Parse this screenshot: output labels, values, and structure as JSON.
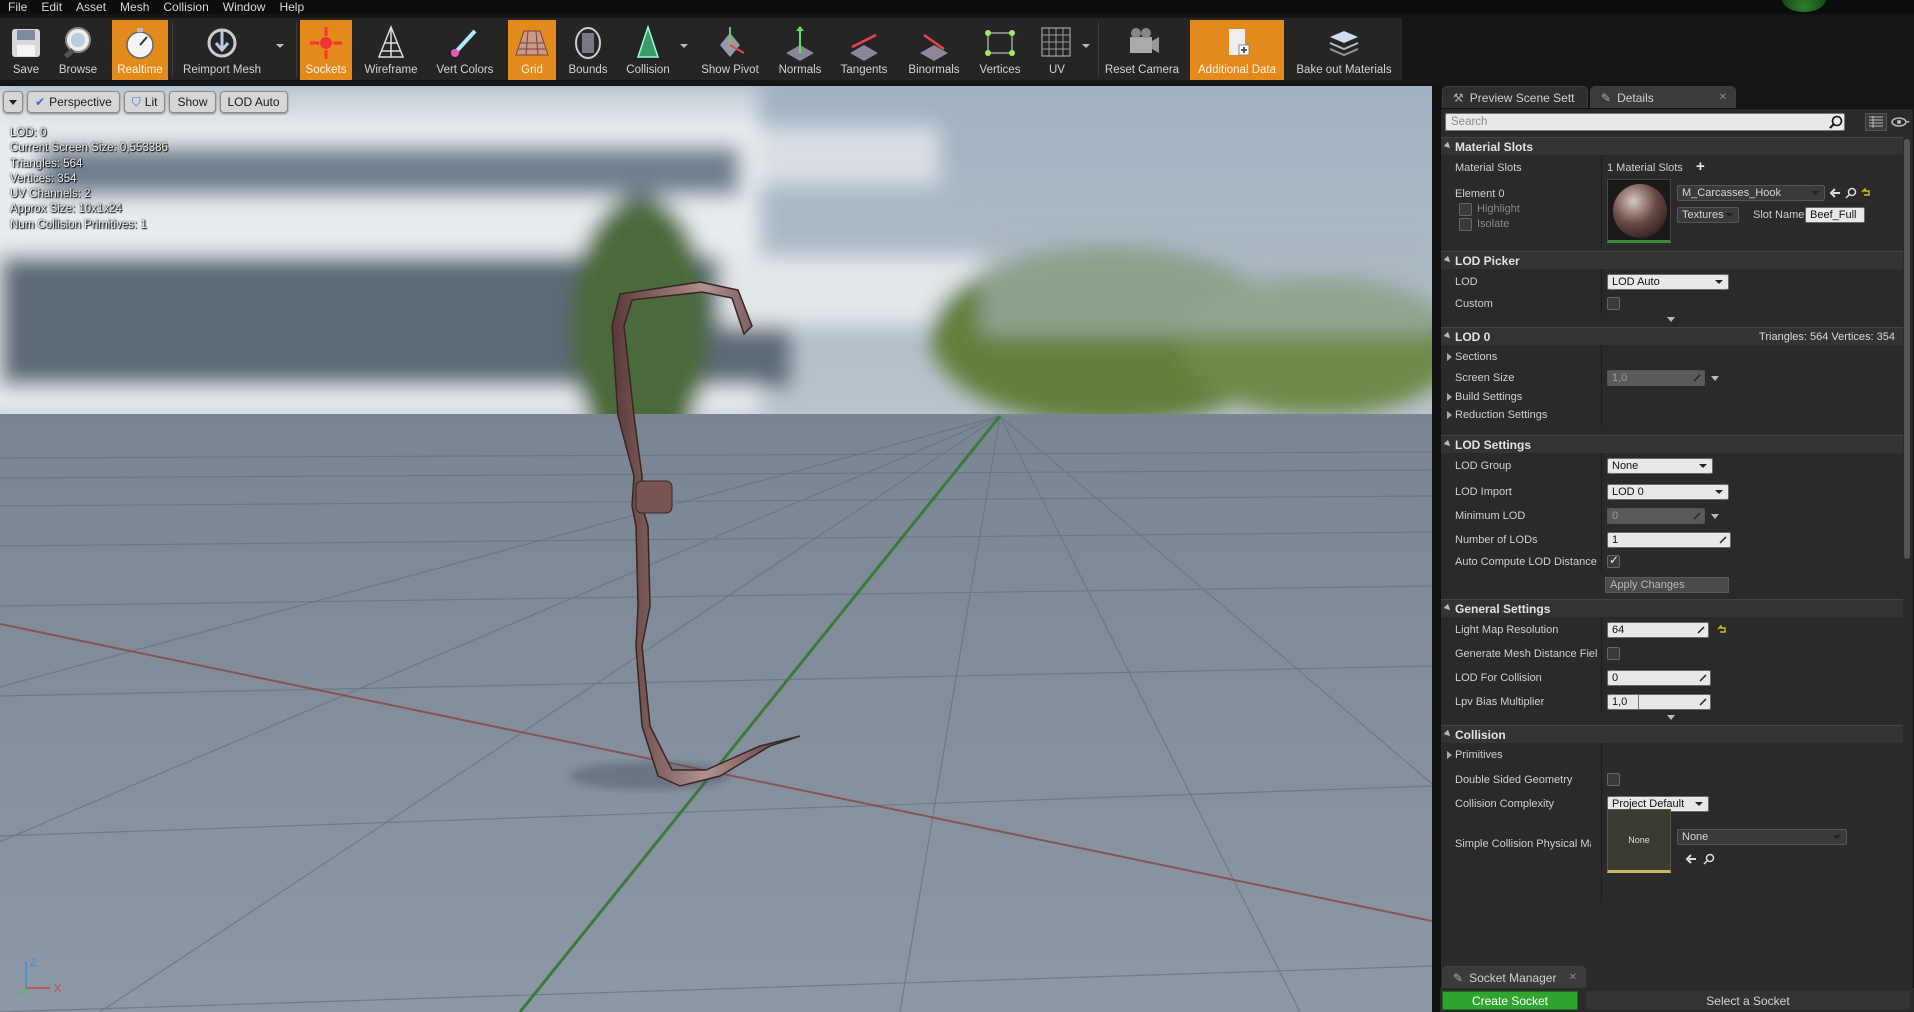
{
  "menu": [
    "File",
    "Edit",
    "Asset",
    "Mesh",
    "Collision",
    "Window",
    "Help"
  ],
  "toolbar": [
    {
      "label": "Save",
      "icon": "save-icon",
      "active": false
    },
    {
      "label": "Browse",
      "icon": "browse-icon",
      "active": false
    },
    {
      "label": "Realtime",
      "icon": "realtime-icon",
      "active": true
    },
    {
      "label": "Reimport Mesh",
      "icon": "reimport-icon",
      "active": false
    },
    {
      "label": "Sockets",
      "icon": "sockets-icon",
      "active": true
    },
    {
      "label": "Wireframe",
      "icon": "wireframe-icon",
      "active": false
    },
    {
      "label": "Vert Colors",
      "icon": "vert-colors-icon",
      "active": false
    },
    {
      "label": "Grid",
      "icon": "grid-icon",
      "active": true
    },
    {
      "label": "Bounds",
      "icon": "bounds-icon",
      "active": false
    },
    {
      "label": "Collision",
      "icon": "collision-icon",
      "active": false
    },
    {
      "label": "Show Pivot",
      "icon": "pivot-icon",
      "active": false
    },
    {
      "label": "Normals",
      "icon": "normals-icon",
      "active": false
    },
    {
      "label": "Tangents",
      "icon": "tangents-icon",
      "active": false
    },
    {
      "label": "Binormals",
      "icon": "binormals-icon",
      "active": false
    },
    {
      "label": "Vertices",
      "icon": "vertices-icon",
      "active": false
    },
    {
      "label": "UV",
      "icon": "uv-icon",
      "active": false
    },
    {
      "label": "Reset Camera",
      "icon": "camera-icon",
      "active": false
    },
    {
      "label": "Additional Data",
      "icon": "additional-data-icon",
      "active": true
    },
    {
      "label": "Bake out Materials",
      "icon": "bake-icon",
      "active": false
    }
  ],
  "viewport": {
    "perspective": "Perspective",
    "lit": "Lit",
    "show": "Show",
    "lod": "LOD Auto",
    "stats": [
      "LOD:  0",
      "Current Screen Size:  0,553386",
      "Triangles:  564",
      "Vertices:  354",
      "UV Channels:  2",
      "Approx Size: 10x1x24",
      "Num Collision Primitives:  1"
    ],
    "gizmo": {
      "z": "Z",
      "x": "X"
    }
  },
  "tabs": {
    "scene": "Preview Scene Sett",
    "details": "Details",
    "close": "✕"
  },
  "search": {
    "placeholder": "Search"
  },
  "material_slots": {
    "header": "Material Slots",
    "label": "Material Slots",
    "count": "1 Material Slots",
    "add": "+",
    "element": "Element 0",
    "highlight": "Highlight",
    "isolate": "Isolate",
    "material": "M_Carcasses_Hook",
    "textures": "Textures",
    "slot_name_label": "Slot Name",
    "slot_name": "Beef_Full"
  },
  "lod_picker": {
    "header": "LOD Picker",
    "lod_label": "LOD",
    "lod_value": "LOD Auto",
    "custom_label": "Custom"
  },
  "lod0": {
    "header": "LOD 0",
    "summary": "Triangles: 564   Vertices: 354",
    "sections": "Sections",
    "screen_size_label": "Screen Size",
    "screen_size": "1,0",
    "build": "Build Settings",
    "reduction": "Reduction Settings"
  },
  "lod_settings": {
    "header": "LOD Settings",
    "group_label": "LOD Group",
    "group": "None",
    "import_label": "LOD Import",
    "import": "LOD 0",
    "min_label": "Minimum LOD",
    "min": "0",
    "num_label": "Number of LODs",
    "num": "1",
    "auto_label": "Auto Compute LOD Distance",
    "apply": "Apply Changes"
  },
  "general": {
    "header": "General Settings",
    "lightmap_label": "Light Map Resolution",
    "lightmap": "64",
    "distfield_label": "Generate Mesh Distance Fiel",
    "lodcol_label": "LOD For Collision",
    "lodcol": "0",
    "lpv_label": "Lpv Bias Multiplier",
    "lpv": "1,0"
  },
  "collision": {
    "header": "Collision",
    "primitives": "Primitives",
    "double_label": "Double Sided Geometry",
    "complexity_label": "Collision Complexity",
    "complexity": "Project Default",
    "phys_label": "Simple Collision Physical Ma",
    "phys_thumb": "None",
    "phys_value": "None"
  },
  "socket_manager": {
    "tab": "Socket Manager",
    "create": "Create Socket",
    "select": "Select a Socket"
  },
  "colors": {
    "accent": "#e28a1c",
    "panel": "#2a2a2a",
    "create": "#2fa52f"
  }
}
